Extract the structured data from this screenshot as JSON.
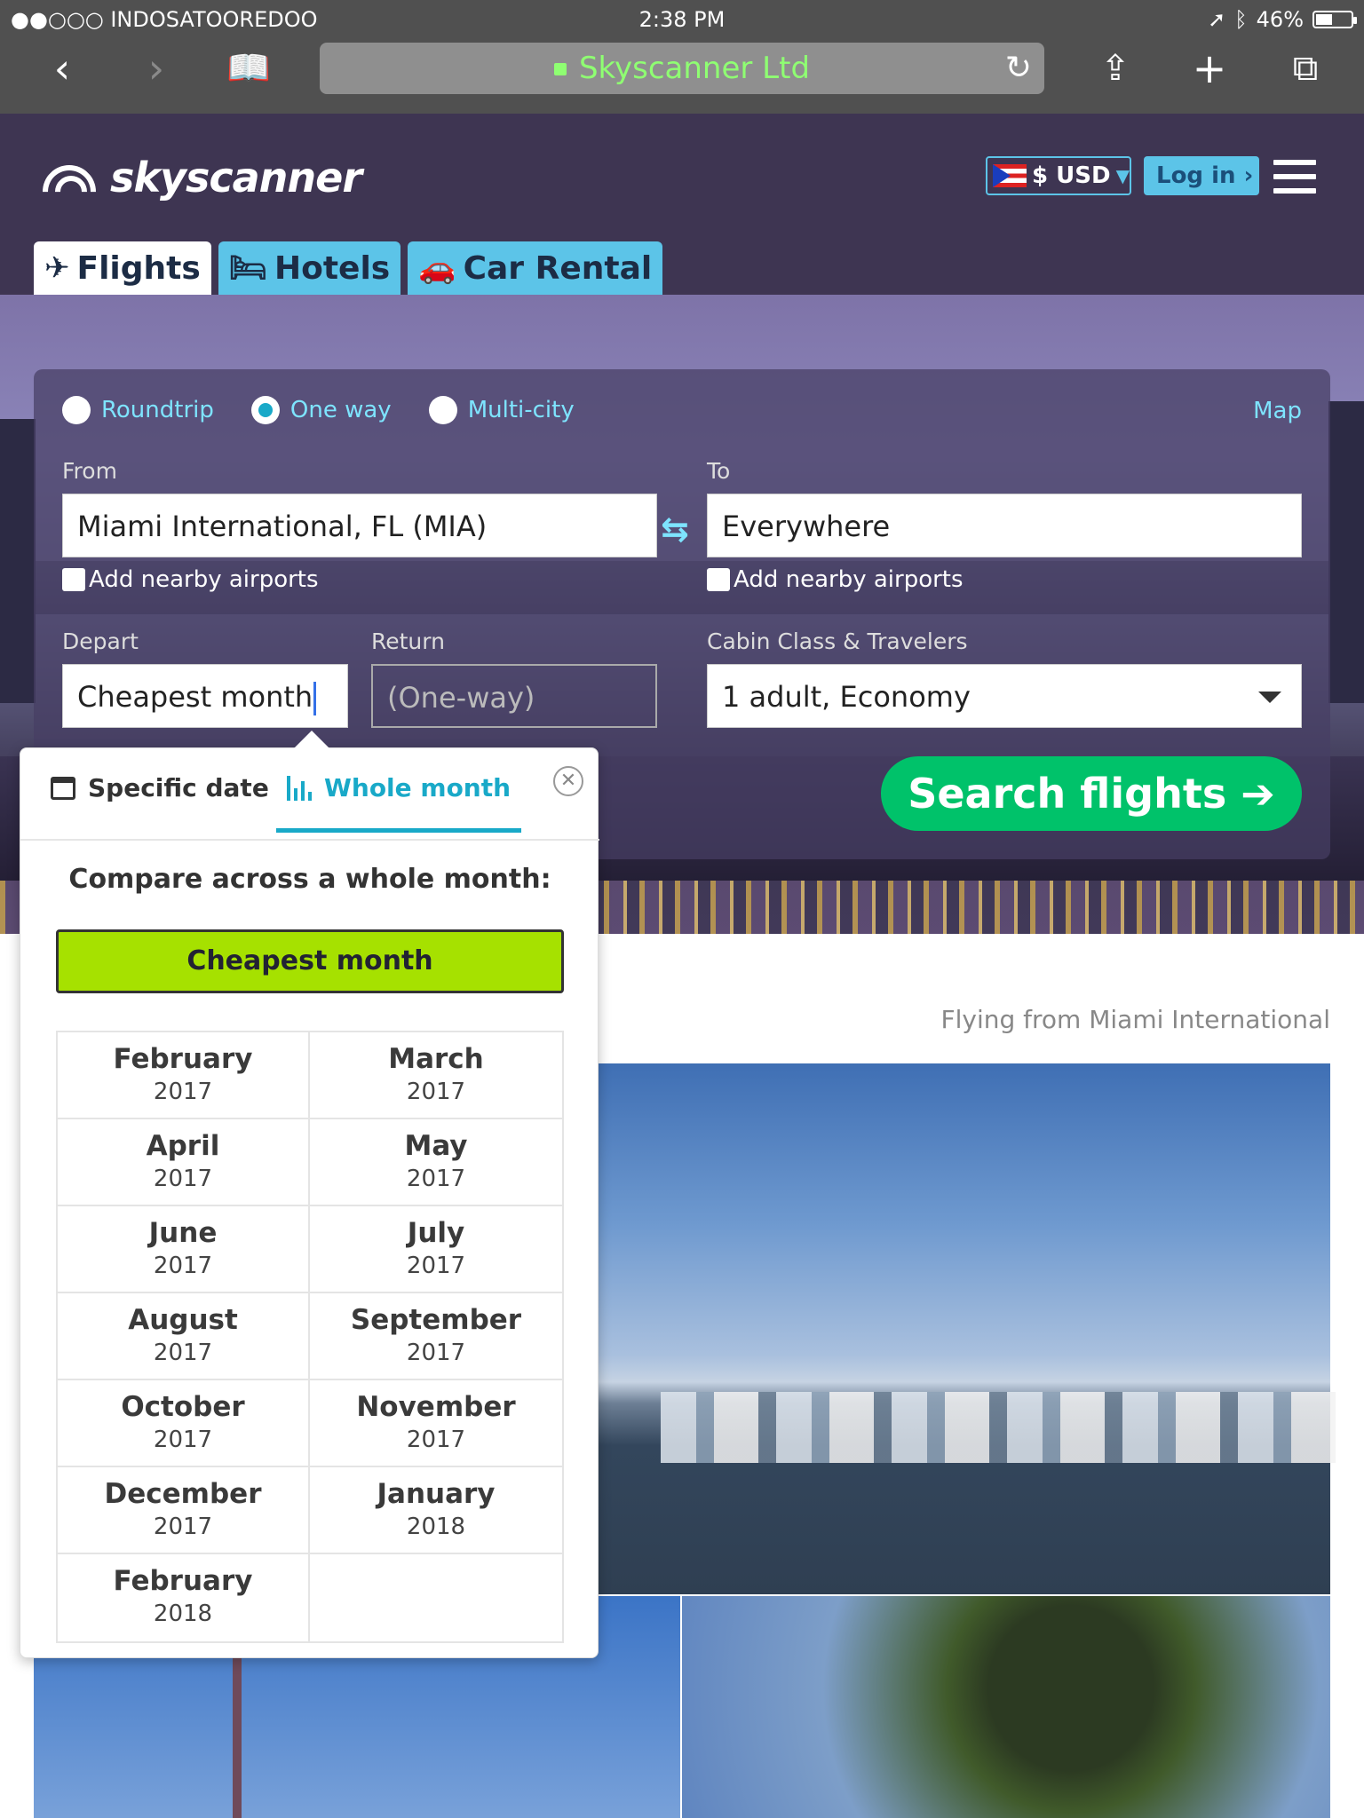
{
  "status_bar": {
    "carrier": "●●○○○ INDOSATOOREDOO",
    "time": "2:38 PM",
    "battery": "46%",
    "battery_level": 0.46
  },
  "browser": {
    "url_title": "Skyscanner Ltd"
  },
  "site": {
    "logo_text": "skyscanner",
    "currency": "$ USD",
    "login": "Log in"
  },
  "tabs": [
    {
      "label": "Flights",
      "icon": "airplane-icon",
      "active": true
    },
    {
      "label": "Hotels",
      "icon": "bed-icon",
      "active": false
    },
    {
      "label": "Car Rental",
      "icon": "car-icon",
      "active": false
    }
  ],
  "search": {
    "trip_types": [
      {
        "label": "Roundtrip",
        "selected": false
      },
      {
        "label": "One way",
        "selected": true
      },
      {
        "label": "Multi-city",
        "selected": false
      }
    ],
    "map_link": "Map",
    "from_label": "From",
    "from_value": "Miami International, FL (MIA)",
    "to_label": "To",
    "to_value": "Everywhere",
    "nearby_label": "Add nearby airports",
    "depart_label": "Depart",
    "depart_value": "Cheapest month",
    "return_label": "Return",
    "return_value": "(One-way)",
    "cabin_label": "Cabin Class & Travelers",
    "cabin_value": "1 adult, Economy",
    "search_button": "Search flights ➔"
  },
  "picker": {
    "tab_specific": "Specific date",
    "tab_whole": "Whole month",
    "title": "Compare across a whole month:",
    "cheapest": "Cheapest month",
    "months": [
      {
        "month": "February",
        "year": "2017"
      },
      {
        "month": "March",
        "year": "2017"
      },
      {
        "month": "April",
        "year": "2017"
      },
      {
        "month": "May",
        "year": "2017"
      },
      {
        "month": "June",
        "year": "2017"
      },
      {
        "month": "July",
        "year": "2017"
      },
      {
        "month": "August",
        "year": "2017"
      },
      {
        "month": "September",
        "year": "2017"
      },
      {
        "month": "October",
        "year": "2017"
      },
      {
        "month": "November",
        "year": "2017"
      },
      {
        "month": "December",
        "year": "2017"
      },
      {
        "month": "January",
        "year": "2018"
      },
      {
        "month": "February",
        "year": "2018"
      },
      {
        "month": "",
        "year": ""
      }
    ]
  },
  "content": {
    "flying_from": "Flying from Miami International"
  },
  "colors": {
    "header_bg": "#3e3552",
    "accent_blue": "#5cc4e8",
    "teal": "#19a9c8",
    "search_green": "#00c26a",
    "cheapest_green": "#a6e100",
    "url_green": "#8fff72"
  }
}
